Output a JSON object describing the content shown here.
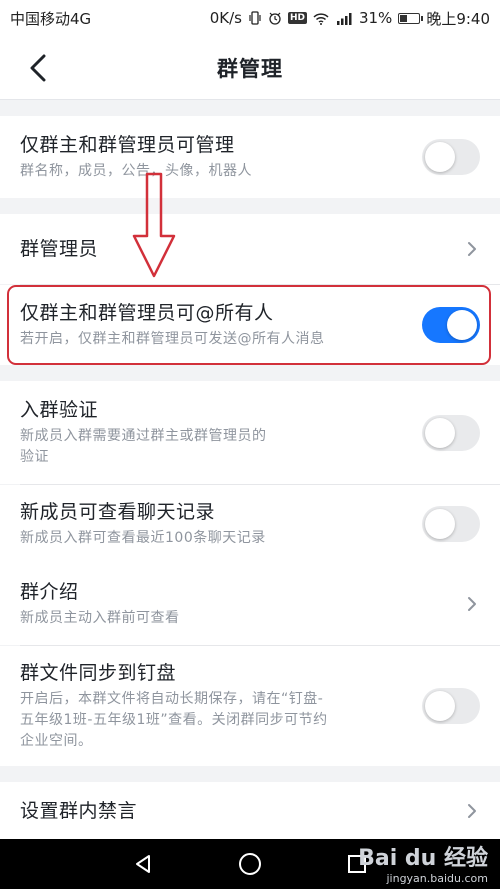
{
  "status_bar": {
    "carrier": "中国移动4G",
    "net_speed": "0K/s",
    "signal": "4G",
    "battery_percent": "31%",
    "time": "晚上9:40"
  },
  "header": {
    "title": "群管理"
  },
  "settings": [
    {
      "title": "仅群主和群管理员可管理",
      "subtitle": "群名称，成员，公告，头像，机器人",
      "control": "toggle",
      "on": false
    },
    {
      "title": "群管理员",
      "control": "chevron"
    },
    {
      "title": "仅群主和群管理员可@所有人",
      "subtitle": "若开启，仅群主和群管理员可发送@所有人消息",
      "control": "toggle",
      "on": true
    },
    {
      "title": "入群验证",
      "subtitle_lines": [
        "新成员入群需要通过群主或群管理员的",
        "验证"
      ],
      "control": "toggle",
      "on": false
    },
    {
      "title": "新成员可查看聊天记录",
      "subtitle": "新成员入群可查看最近100条聊天记录",
      "control": "toggle",
      "on": false
    },
    {
      "title": "群介绍",
      "subtitle": "新成员主动入群前可查看",
      "control": "chevron"
    },
    {
      "title": "群文件同步到钉盘",
      "subtitle_lines": [
        "开启后，本群文件将自动长期保存，请在“钉盘-",
        "五年级1班-五年级1班”查看。关闭群同步可节约",
        "企业空间。"
      ],
      "control": "toggle",
      "on": false
    },
    {
      "title": "设置群内禁言",
      "control": "chevron"
    }
  ],
  "watermark": {
    "logo": "Bai du 经验",
    "url": "jingyan.baidu.com"
  },
  "colors": {
    "accent": "#1677ff",
    "annotation": "#d2303a",
    "toggle_off": "#e9eaec"
  }
}
